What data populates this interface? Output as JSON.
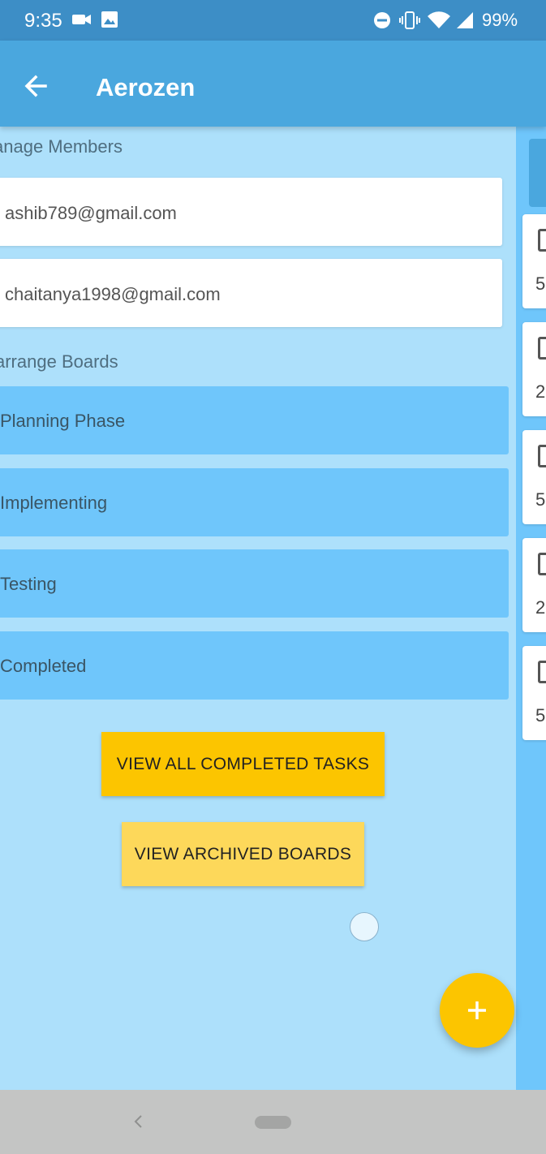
{
  "status_bar": {
    "time": "9:35",
    "battery": "99%",
    "icons": [
      "video-icon",
      "image-icon",
      "dnd-icon",
      "vibrate-icon",
      "wifi-icon",
      "signal-icon"
    ]
  },
  "app_bar": {
    "title": "Aerozen",
    "back_icon": "arrow-back-icon"
  },
  "drawer": {
    "members_label": "anage Members",
    "members": [
      {
        "email": "ashib789@gmail.com"
      },
      {
        "email": "chaitanya1998@gmail.com"
      }
    ],
    "boards_label": "arrange Boards",
    "boards": [
      {
        "label": "Planning Phase"
      },
      {
        "label": "Implementing"
      },
      {
        "label": "Testing"
      },
      {
        "label": "Completed"
      }
    ],
    "view_completed_label": "VIEW ALL COMPLETED TASKS",
    "view_archived_label": "VIEW ARCHIVED BOARDS"
  },
  "right_panel": {
    "task_counts": [
      "5",
      "2",
      "5",
      "2",
      "5"
    ]
  },
  "fab": {
    "icon": "plus-icon"
  },
  "colors": {
    "status_bar": "#3d8ec6",
    "app_bar": "#4aa7de",
    "drawer_bg": "#ade0fb",
    "board_item": "#6fc6fb",
    "accent_primary": "#fcc500",
    "accent_secondary": "#fdd85a",
    "nav_bar": "#c4c5c4"
  }
}
